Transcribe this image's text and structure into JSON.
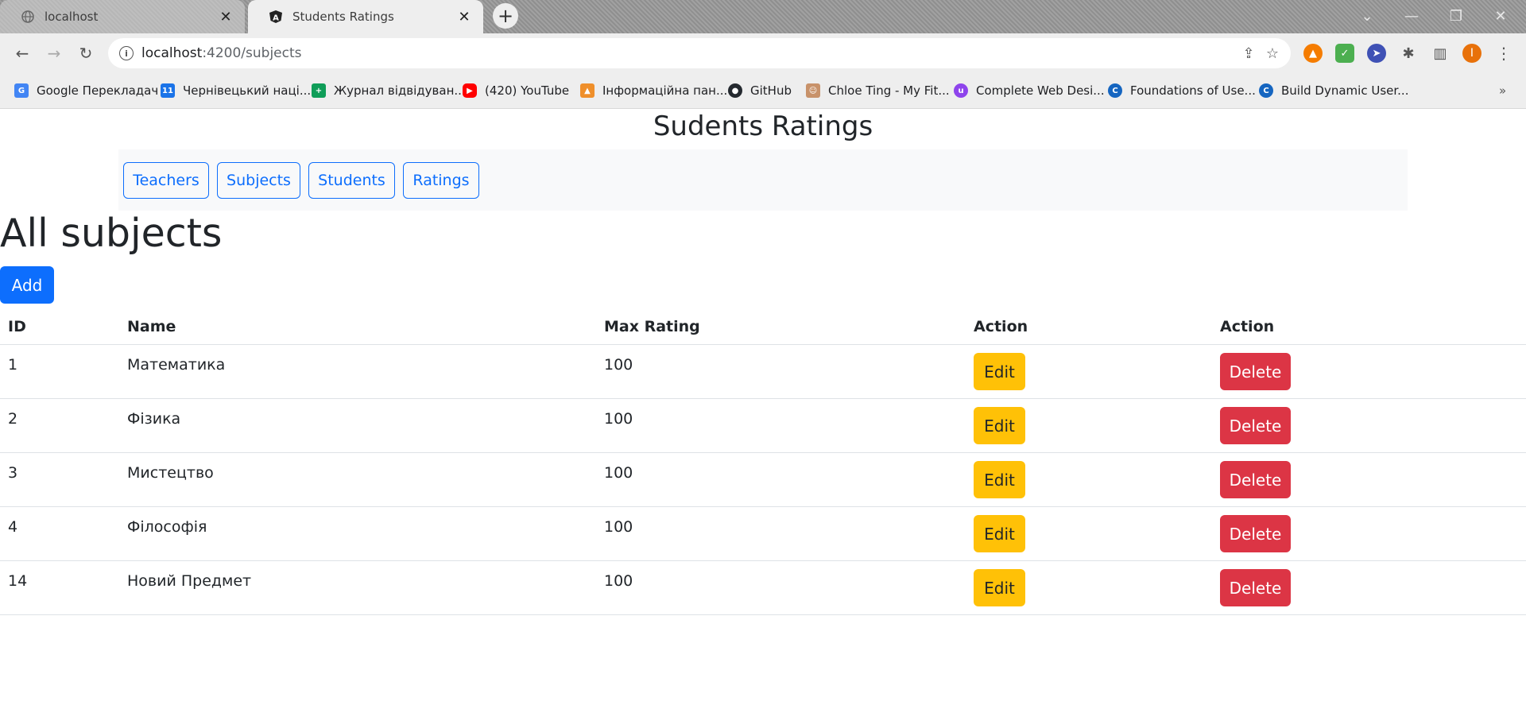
{
  "browser": {
    "tabs": [
      {
        "title": "localhost",
        "active": false
      },
      {
        "title": "Students Ratings",
        "active": true
      }
    ],
    "url_host": "localhost",
    "url_path": ":4200/subjects",
    "profile_initial": "I",
    "bookmarks": [
      "Google Перекладач",
      "Чернівецький наці...",
      "Журнал відвідуван...",
      "(420) YouTube",
      "Інформаційна пан...",
      "GitHub",
      "Chloe Ting - My Fit...",
      "Complete Web Desi...",
      "Foundations of Use...",
      "Build Dynamic User..."
    ]
  },
  "app": {
    "title": "Sudents Ratings",
    "nav": [
      "Teachers",
      "Subjects",
      "Students",
      "Ratings"
    ],
    "heading": "All subjects",
    "add_label": "Add",
    "columns": [
      "ID",
      "Name",
      "Max Rating",
      "Action",
      "Action"
    ],
    "rows": [
      {
        "id": "1",
        "name": "Математика",
        "max_rating": "100"
      },
      {
        "id": "2",
        "name": "Фізика",
        "max_rating": "100"
      },
      {
        "id": "3",
        "name": "Мистецтво",
        "max_rating": "100"
      },
      {
        "id": "4",
        "name": "Філософія",
        "max_rating": "100"
      },
      {
        "id": "14",
        "name": "Новий Предмет",
        "max_rating": "100"
      }
    ],
    "edit_label": "Edit",
    "delete_label": "Delete"
  },
  "colors": {
    "primary": "#0d6efd",
    "warning": "#ffc107",
    "danger": "#dc3545",
    "navbar_bg": "#f8f9fa"
  }
}
